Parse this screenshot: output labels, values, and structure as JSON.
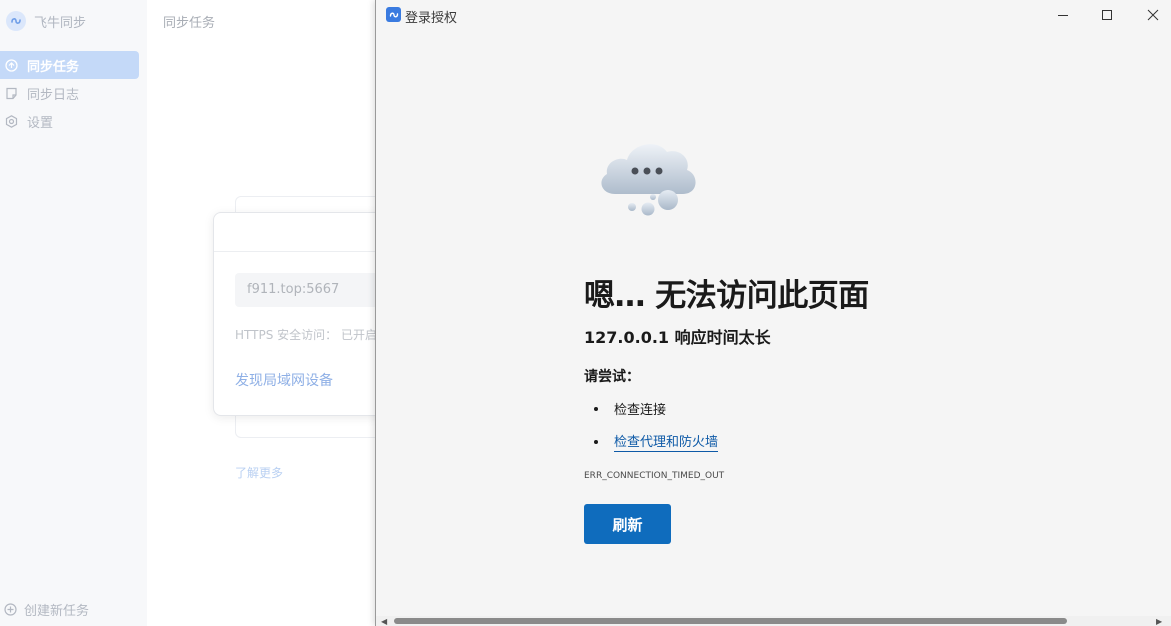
{
  "app": {
    "brand": "飞牛同步",
    "page_title": "同步任务",
    "nav": [
      {
        "label": "同步任务",
        "icon": "sync-icon",
        "active": true
      },
      {
        "label": "同步日志",
        "icon": "log-icon",
        "active": false
      },
      {
        "label": "设置",
        "icon": "gear-icon",
        "active": false
      }
    ],
    "new_task": "创建新任务",
    "card": {
      "address": "f911.top:5667",
      "https_label": "HTTPS 安全访问：",
      "https_value": "已开启",
      "discover": "发现局域网设备"
    },
    "learn_more": "了解更多"
  },
  "browser": {
    "title": "登录授权",
    "error": {
      "heading": "嗯… 无法访问此页面",
      "subheading": "127.0.0.1 响应时间太长",
      "try_label": "请尝试：",
      "suggestions": [
        "检查连接",
        "检查代理和防火墙"
      ],
      "code": "ERR_CONNECTION_TIMED_OUT",
      "refresh": "刷新"
    }
  },
  "colors": {
    "accent": "#0f6cbd",
    "sidebar_active": "#c4d9f8",
    "link": "#0e5aa7"
  }
}
